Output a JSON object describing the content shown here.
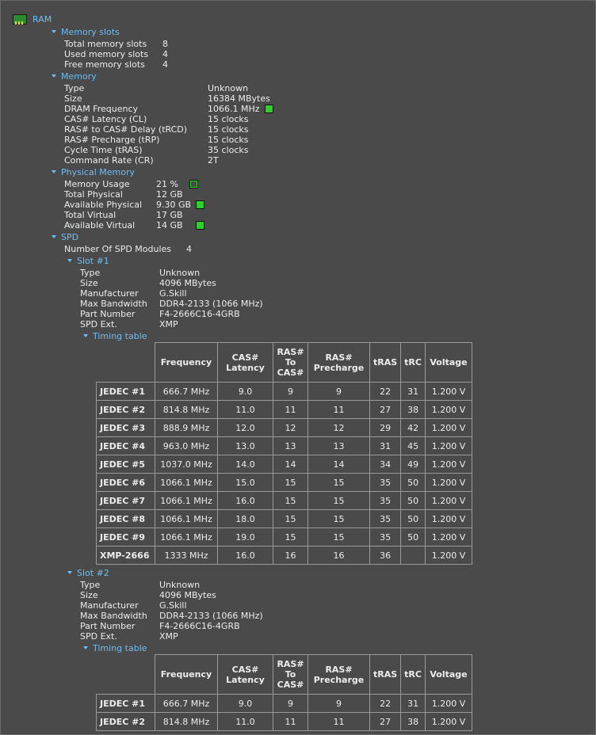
{
  "root_label": "RAM",
  "memory_slots": {
    "header": "Memory slots",
    "rows": [
      {
        "label": "Total memory slots",
        "value": "8"
      },
      {
        "label": "Used memory slots",
        "value": "4"
      },
      {
        "label": "Free memory slots",
        "value": "4"
      }
    ]
  },
  "memory": {
    "header": "Memory",
    "rows": [
      {
        "label": "Type",
        "value": "Unknown"
      },
      {
        "label": "Size",
        "value": "16384 MBytes"
      },
      {
        "label": "DRAM Frequency",
        "value": "1066.1 MHz"
      },
      {
        "label": "CAS# Latency (CL)",
        "value": "15 clocks"
      },
      {
        "label": "RAS# to CAS# Delay (tRCD)",
        "value": "15 clocks"
      },
      {
        "label": "RAS# Precharge (tRP)",
        "value": "15 clocks"
      },
      {
        "label": "Cycle Time (tRAS)",
        "value": "35 clocks"
      },
      {
        "label": "Command Rate (CR)",
        "value": "2T"
      }
    ]
  },
  "physical_memory": {
    "header": "Physical Memory",
    "rows": [
      {
        "label": "Memory Usage",
        "value": "21 %"
      },
      {
        "label": "Total Physical",
        "value": "12 GB"
      },
      {
        "label": "Available Physical",
        "value": "9.30 GB"
      },
      {
        "label": "Total Virtual",
        "value": "17 GB"
      },
      {
        "label": "Available Virtual",
        "value": "14 GB"
      }
    ]
  },
  "spd": {
    "header": "SPD",
    "modules_label": "Number Of SPD Modules",
    "modules_value": "4",
    "timing_headers": [
      "Frequency",
      "CAS#\nLatency",
      "RAS#\nTo\nCAS#",
      "RAS#\nPrecharge",
      "tRAS",
      "tRC",
      "Voltage"
    ],
    "slots": [
      {
        "header": "Slot #1",
        "rows": [
          {
            "label": "Type",
            "value": "Unknown"
          },
          {
            "label": "Size",
            "value": "4096 MBytes"
          },
          {
            "label": "Manufacturer",
            "value": "G.Skill"
          },
          {
            "label": "Max Bandwidth",
            "value": "DDR4-2133 (1066 MHz)"
          },
          {
            "label": "Part Number",
            "value": "F4-2666C16-4GRB"
          },
          {
            "label": "SPD Ext.",
            "value": "XMP"
          }
        ],
        "timing_header": "Timing table",
        "timing_rows": [
          [
            "JEDEC #1",
            "666.7 MHz",
            "9.0",
            "9",
            "9",
            "22",
            "31",
            "1.200 V"
          ],
          [
            "JEDEC #2",
            "814.8 MHz",
            "11.0",
            "11",
            "11",
            "27",
            "38",
            "1.200 V"
          ],
          [
            "JEDEC #3",
            "888.9 MHz",
            "12.0",
            "12",
            "12",
            "29",
            "42",
            "1.200 V"
          ],
          [
            "JEDEC #4",
            "963.0 MHz",
            "13.0",
            "13",
            "13",
            "31",
            "45",
            "1.200 V"
          ],
          [
            "JEDEC #5",
            "1037.0 MHz",
            "14.0",
            "14",
            "14",
            "34",
            "49",
            "1.200 V"
          ],
          [
            "JEDEC #6",
            "1066.1 MHz",
            "15.0",
            "15",
            "15",
            "35",
            "50",
            "1.200 V"
          ],
          [
            "JEDEC #7",
            "1066.1 MHz",
            "16.0",
            "15",
            "15",
            "35",
            "50",
            "1.200 V"
          ],
          [
            "JEDEC #8",
            "1066.1 MHz",
            "18.0",
            "15",
            "15",
            "35",
            "50",
            "1.200 V"
          ],
          [
            "JEDEC #9",
            "1066.1 MHz",
            "19.0",
            "15",
            "15",
            "35",
            "50",
            "1.200 V"
          ],
          [
            "XMP-2666",
            "1333 MHz",
            "16.0",
            "16",
            "16",
            "36",
            "",
            "1.200 V"
          ]
        ]
      },
      {
        "header": "Slot #2",
        "rows": [
          {
            "label": "Type",
            "value": "Unknown"
          },
          {
            "label": "Size",
            "value": "4096 MBytes"
          },
          {
            "label": "Manufacturer",
            "value": "G.Skill"
          },
          {
            "label": "Max Bandwidth",
            "value": "DDR4-2133 (1066 MHz)"
          },
          {
            "label": "Part Number",
            "value": "F4-2666C16-4GRB"
          },
          {
            "label": "SPD Ext.",
            "value": "XMP"
          }
        ],
        "timing_header": "Timing table",
        "timing_rows": [
          [
            "JEDEC #1",
            "666.7 MHz",
            "9.0",
            "9",
            "9",
            "22",
            "31",
            "1.200 V"
          ],
          [
            "JEDEC #2",
            "814.8 MHz",
            "11.0",
            "11",
            "11",
            "27",
            "38",
            "1.200 V"
          ]
        ]
      }
    ]
  }
}
